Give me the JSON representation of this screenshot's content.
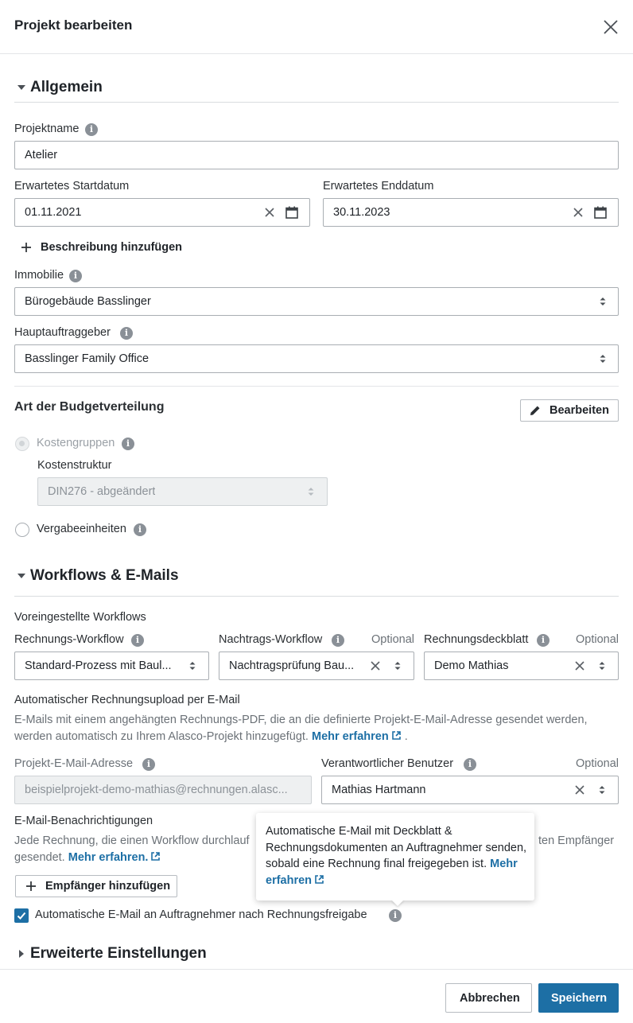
{
  "dialog": {
    "title": "Projekt bearbeiten"
  },
  "general": {
    "section_title": "Allgemein",
    "project_name_label": "Projektname",
    "project_name_value": "Atelier",
    "start_date_label": "Erwartetes Startdatum",
    "start_date_value": "01.11.2021",
    "end_date_label": "Erwartetes Enddatum",
    "end_date_value": "30.11.2023",
    "add_description": "Beschreibung hinzufügen",
    "property_label": "Immobilie",
    "property_value": "Bürogebäude Basslinger",
    "client_label": "Hauptauftraggeber",
    "client_value": "Basslinger Family Office"
  },
  "budget": {
    "title": "Art der Budgetverteilung",
    "edit_button": "Bearbeiten",
    "option_cost_groups": "Kostengruppen",
    "cost_structure_label": "Kostenstruktur",
    "cost_structure_value": "DIN276 - abgeändert",
    "option_award_units": "Vergabeeinheiten"
  },
  "workflows": {
    "section_title": "Workflows & E-Mails",
    "preset_title": "Voreingestellte Workflows",
    "invoice_workflow_label": "Rechnungs-Workflow",
    "invoice_workflow_value": "Standard-Prozess mit Baul...",
    "supplement_workflow_label": "Nachtrags-Workflow",
    "supplement_workflow_optional": "Optional",
    "supplement_workflow_value": "Nachtragsprüfung Bau...",
    "cover_sheet_label": "Rechnungsdeckblatt",
    "cover_sheet_optional": "Optional",
    "cover_sheet_value": "Demo Mathias",
    "auto_upload_title": "Automatischer Rechnungsupload per E-Mail",
    "auto_upload_text_1": "E-Mails mit einem angehängten Rechnungs-PDF, die an die definierte Projekt-E-Mail-Adresse gesendet werden,",
    "auto_upload_text_2": "werden automatisch zu Ihrem Alasco-Projekt hinzugefügt.",
    "auto_upload_link": "Mehr erfahren",
    "project_email_label": "Projekt-E-Mail-Adresse",
    "project_email_value": "beispielprojekt-demo-mathias@rechnungen.alasc...",
    "responsible_user_label": "Verantwortlicher Benutzer",
    "responsible_user_optional": "Optional",
    "responsible_user_value": "Mathias Hartmann",
    "notifications_title": "E-Mail-Benachrichtigungen",
    "notifications_text_1a": "Jede Rechnung, die einen Workflow durchlauf",
    "notifications_text_1b": "ten Empfänger",
    "notifications_text_2": "gesendet.",
    "notifications_link": "Mehr erfahren.",
    "add_recipient": "Empfänger hinzufügen",
    "auto_email_checkbox": "Automatische E-Mail an Auftragnehmer nach Rechnungsfreigabe"
  },
  "tooltip": {
    "text": "Automatische E-Mail mit Deckblatt & Rechnungsdokumenten an Auftragnehmer senden, sobald eine Rechnung final freigegeben ist.",
    "link": "Mehr erfahren"
  },
  "advanced": {
    "section_title": "Erweiterte Einstellungen"
  },
  "footer": {
    "cancel": "Abbrechen",
    "save": "Speichern"
  },
  "colors": {
    "primary": "#1d6fa5",
    "border": "#a9aeb3",
    "info_icon": "#8a9097"
  },
  "icons": [
    "close-icon",
    "caret-down-icon",
    "info-icon",
    "clear-icon",
    "calendar-icon",
    "plus-icon",
    "sort-icon",
    "pencil-icon",
    "external-link-icon",
    "check-icon",
    "caret-right-icon"
  ]
}
